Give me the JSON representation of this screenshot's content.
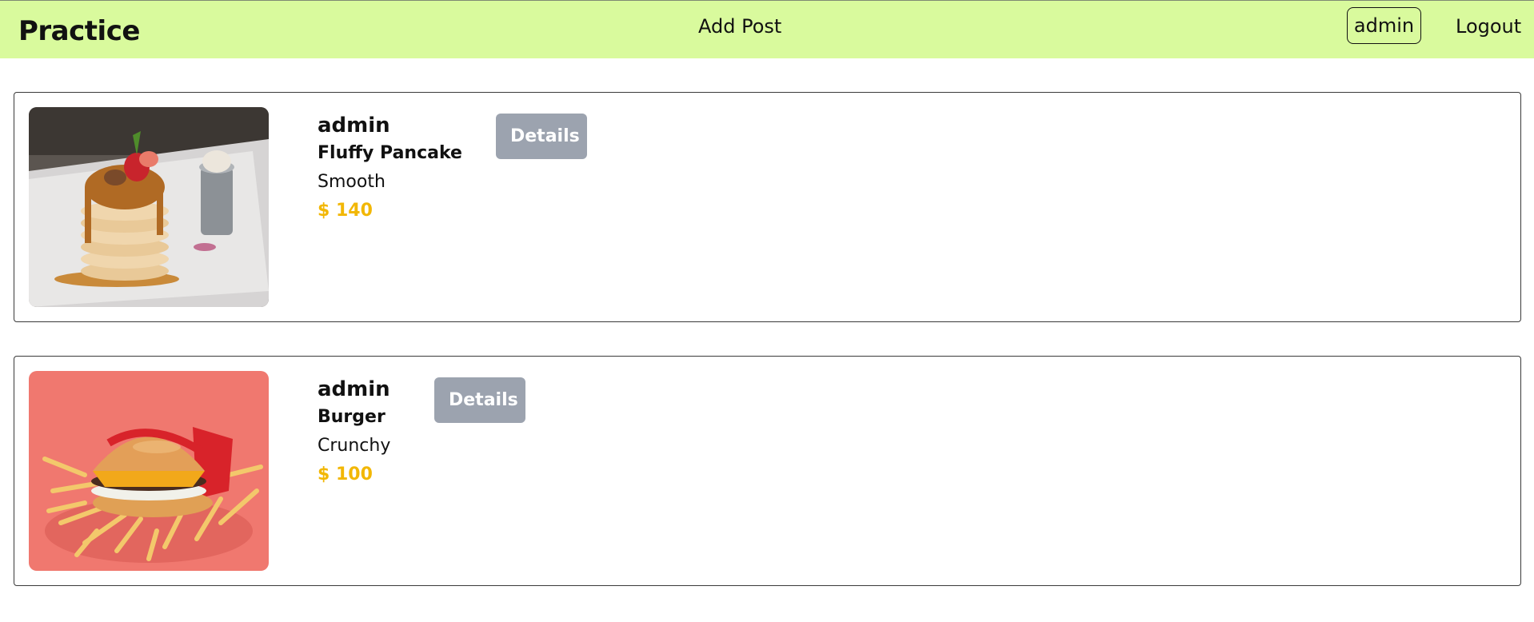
{
  "navbar": {
    "brand": "Practice",
    "add_post": "Add Post",
    "user": "admin",
    "logout": "Logout",
    "background": "#d9fa9d"
  },
  "posts": [
    {
      "author": "admin",
      "title": "Fluffy Pancake",
      "description": "Smooth",
      "price": "$ 140",
      "details_label": "Details",
      "image": "pancake-photo"
    },
    {
      "author": "admin",
      "title": "Burger",
      "description": "Crunchy",
      "price": "$ 100",
      "details_label": "Details",
      "image": "burger-photo"
    }
  ],
  "colors": {
    "price": "#f2b705",
    "details_button": "#9ca3af"
  }
}
